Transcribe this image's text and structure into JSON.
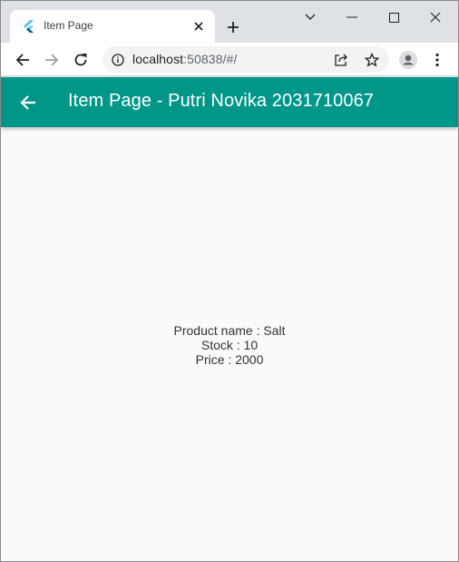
{
  "browser": {
    "tab": {
      "title": "Item Page",
      "favicon": "flutter-icon"
    },
    "window_controls": [
      "chevron-down-icon",
      "minimize-icon",
      "maximize-icon",
      "close-icon"
    ],
    "url": {
      "host": "localhost",
      "rest": ":50838/#/"
    }
  },
  "app": {
    "appbar": {
      "title": "Item Page - Putri Novika 2031710067",
      "color": "#009688"
    },
    "product": {
      "name_line": "Product name : Salt",
      "stock_line": "Stock : 10",
      "price_line": "Price : 2000"
    }
  }
}
